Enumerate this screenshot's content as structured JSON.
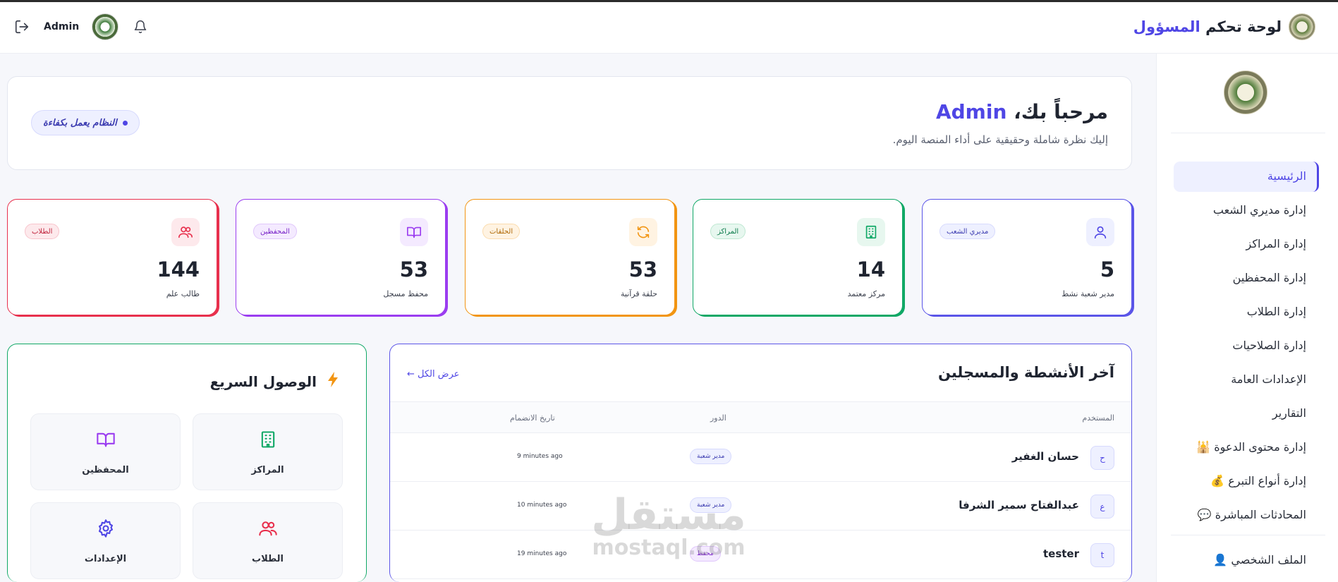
{
  "header": {
    "brand_prefix": "لوحة تحكم",
    "brand_accent": "المسؤول",
    "user_name": "Admin",
    "icons": [
      "logout-icon",
      "bell-icon"
    ]
  },
  "sidebar": {
    "items": [
      {
        "label": "الرئيسية",
        "active": true
      },
      {
        "label": "إدارة مديري الشعب"
      },
      {
        "label": "إدارة المراكز"
      },
      {
        "label": "إدارة المحفظين"
      },
      {
        "label": "إدارة الطلاب"
      },
      {
        "label": "إدارة الصلاحيات"
      },
      {
        "label": "الإعدادات العامة"
      },
      {
        "label": "التقارير"
      },
      {
        "label": "إدارة محتوى الدعوة 🕌"
      },
      {
        "label": "إدارة أنواع التبرع 💰"
      },
      {
        "label": "المحادثات المباشرة 💬"
      },
      {
        "label": "الملف الشخصي 👤"
      }
    ]
  },
  "welcome": {
    "greeting": "مرحباً بك،",
    "name": "Admin",
    "subtitle": "إليك نظرة شاملة وحقيقية على أداء المنصة اليوم.",
    "status": "النظام يعمل بكفاءة"
  },
  "stats": [
    {
      "tag": "مديري الشعب",
      "value": "5",
      "label": "مدير شعبة نشط",
      "icon": "user-icon",
      "color": "#5b55e8"
    },
    {
      "tag": "المراكز",
      "value": "14",
      "label": "مركز معتمد",
      "icon": "building-icon",
      "color": "#10a866"
    },
    {
      "tag": "الحلقات",
      "value": "53",
      "label": "حلقة قرآنية",
      "icon": "refresh-icon",
      "color": "#f29512"
    },
    {
      "tag": "المحفظين",
      "value": "53",
      "label": "محفظ مسجل",
      "icon": "book-icon",
      "color": "#9b3df0"
    },
    {
      "tag": "الطلاب",
      "value": "144",
      "label": "طالب علم",
      "icon": "users-icon",
      "color": "#e8304d"
    }
  ],
  "activity": {
    "title": "آخر الأنشطة والمسجلين",
    "view_all": "عرض الكل ←",
    "columns": {
      "user": "المستخدم",
      "role": "الدور",
      "joined": "تاريخ الانضمام"
    },
    "rows": [
      {
        "initial": "ح",
        "name": "حسان الغفير",
        "role": "مدير شعبة",
        "joined": "9 minutes ago"
      },
      {
        "initial": "ع",
        "name": "عبدالفتاح سمير الشرفا",
        "role": "مدير شعبة",
        "joined": "10 minutes ago"
      },
      {
        "initial": "t",
        "name": "tester",
        "role": "محفظ",
        "joined": "19 minutes ago"
      }
    ]
  },
  "quick": {
    "title": "الوصول السريع",
    "items": [
      {
        "label": "المراكز",
        "icon": "building-icon"
      },
      {
        "label": "المحفظين",
        "icon": "book-icon"
      },
      {
        "label": "الطلاب",
        "icon": "users-icon"
      },
      {
        "label": "الإعدادات",
        "icon": "gear-icon"
      }
    ]
  },
  "watermark": {
    "ar": "مستقل",
    "en": "mostaql.com"
  }
}
